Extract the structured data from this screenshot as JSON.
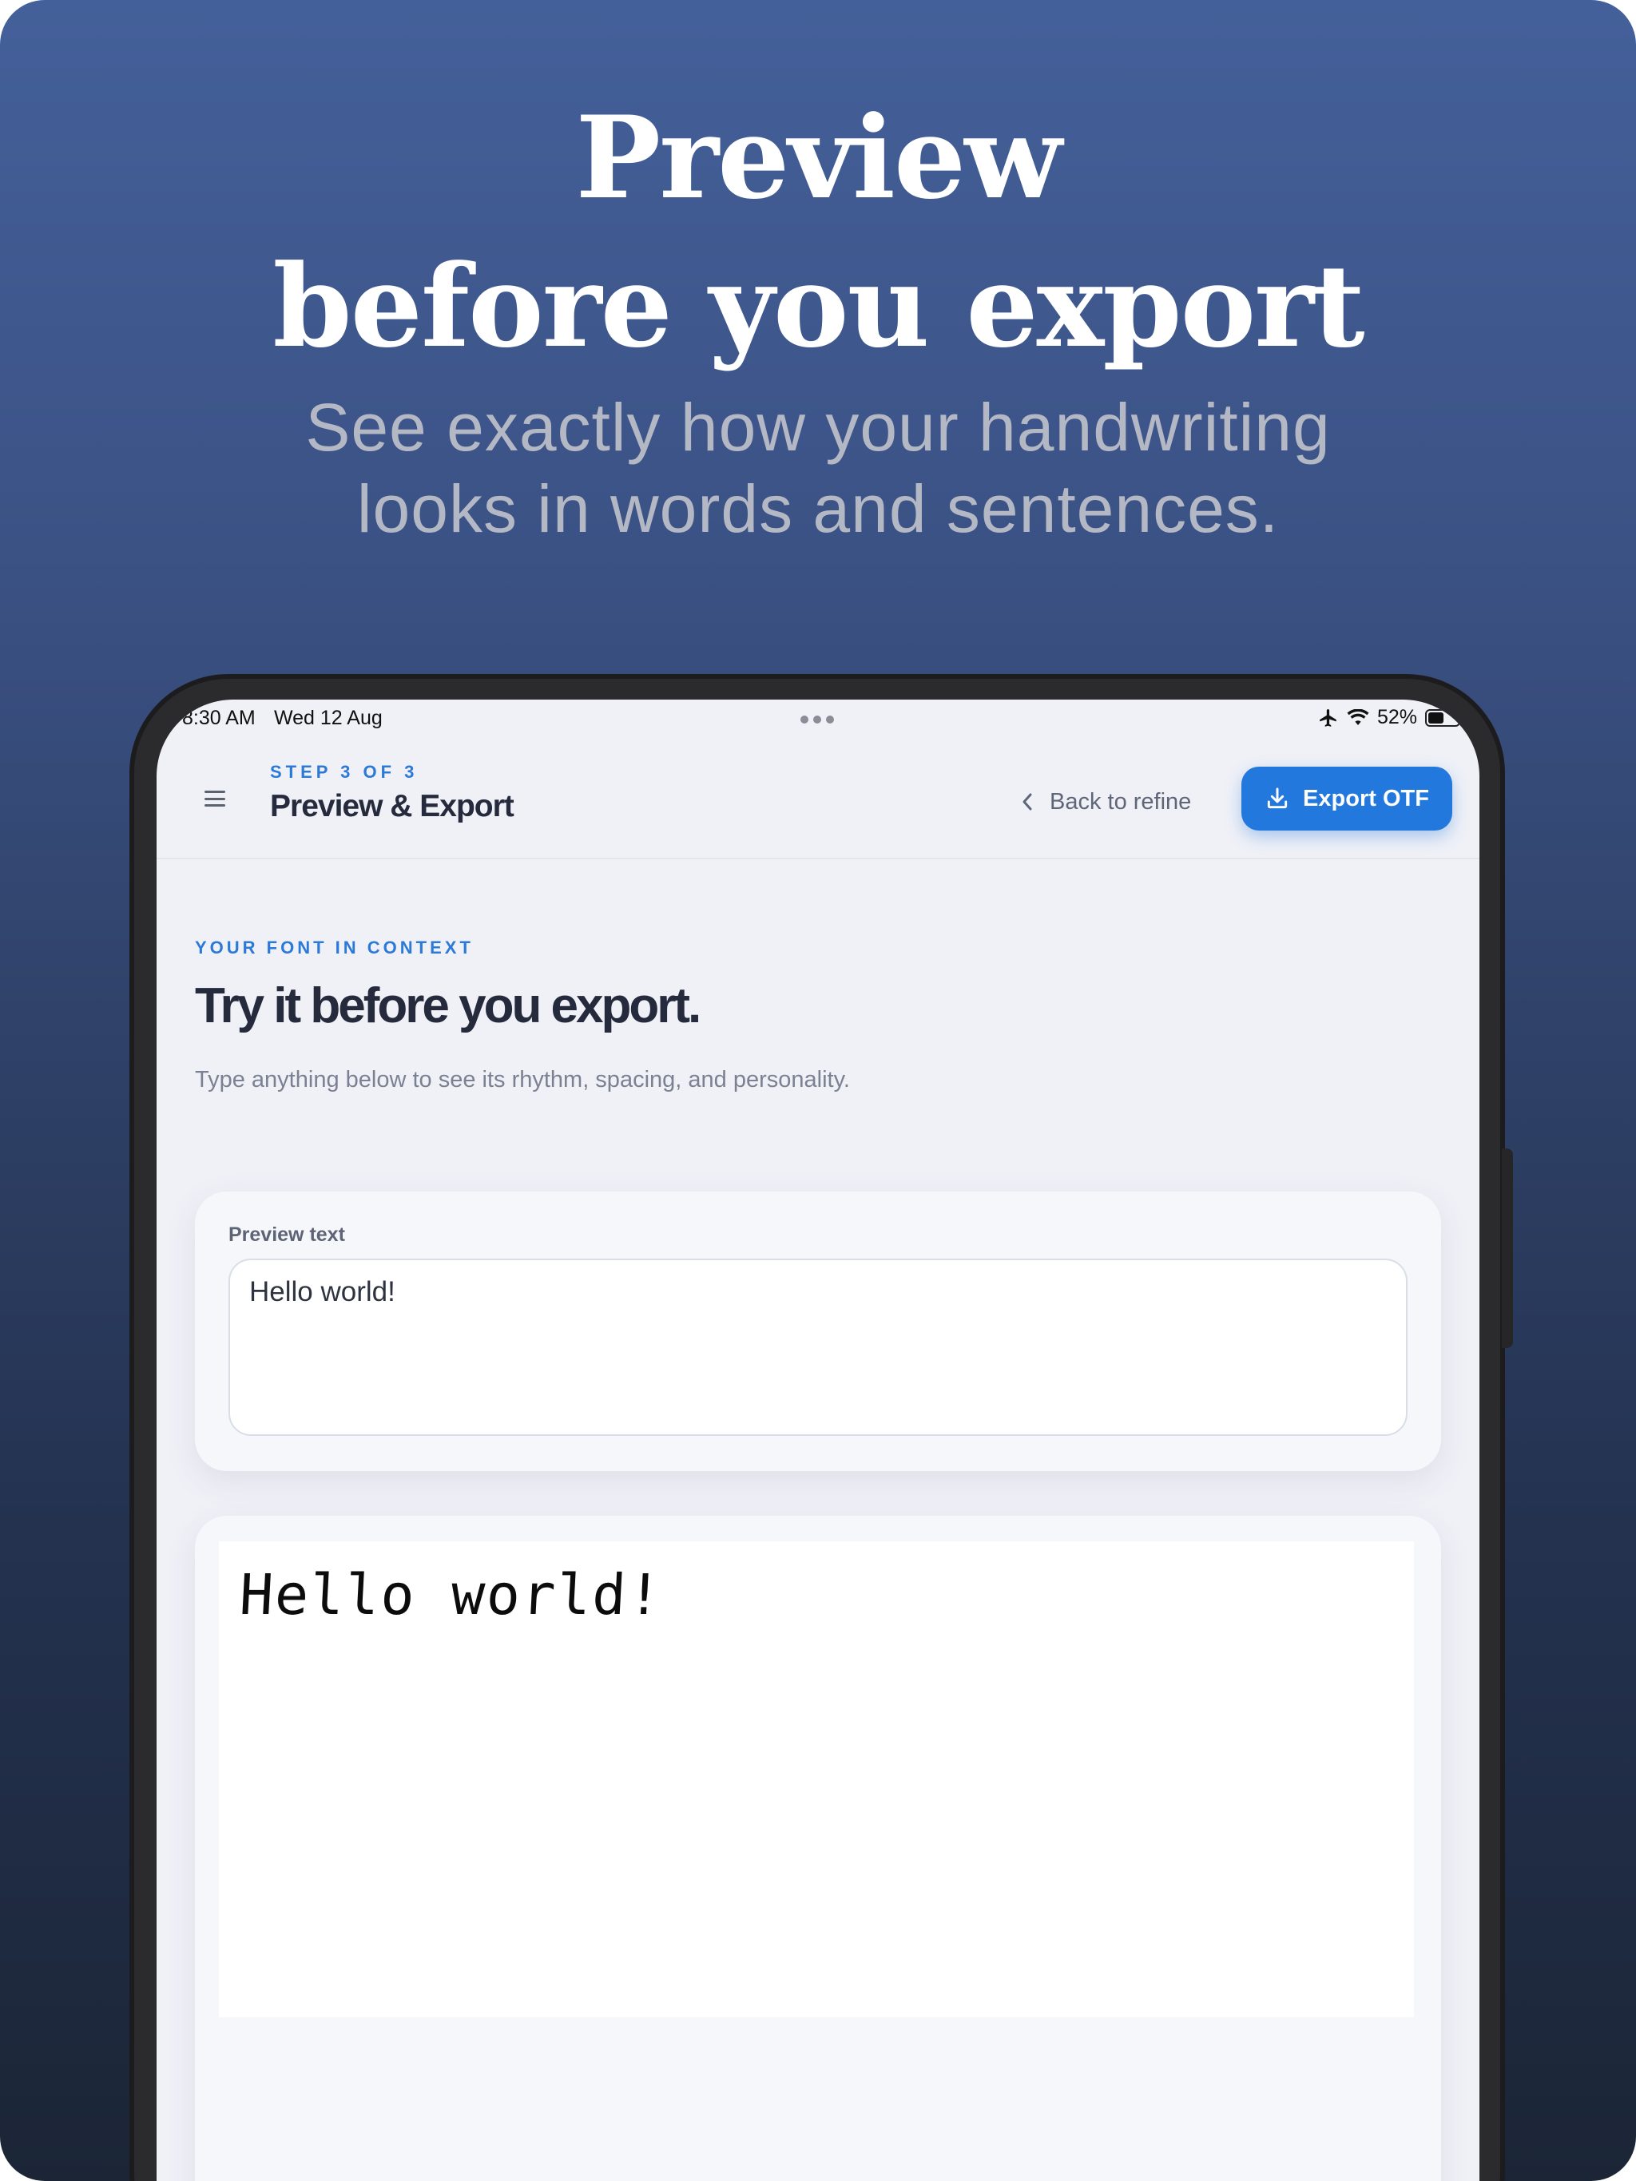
{
  "marketing": {
    "headline_line1": "Preview",
    "headline_line2": "before you export",
    "subheadline_line1": "See exactly how your handwriting",
    "subheadline_line2": "looks in words and sentences."
  },
  "status_bar": {
    "time": "8:30 AM",
    "date": "Wed 12 Aug",
    "battery": "52%",
    "battery_level": 0.52,
    "icons": [
      "airplane-icon",
      "wifi-icon",
      "battery-icon"
    ]
  },
  "header": {
    "menu_icon": "hamburger-menu-icon",
    "step_label": "STEP 3 OF 3",
    "title": "Preview & Export",
    "back_label": "Back to refine",
    "back_icon": "chevron-left-icon",
    "export_label": "Export OTF",
    "export_icon": "download-icon",
    "accent_color": "#2378de"
  },
  "section": {
    "eyebrow": "YOUR FONT IN CONTEXT",
    "title": "Try it before you export.",
    "description": "Type anything below to see its rhythm, spacing, and personality."
  },
  "preview_input": {
    "label": "Preview text",
    "value": "Hello world!"
  },
  "preview_output": {
    "rendered_text": "Hello world!"
  }
}
